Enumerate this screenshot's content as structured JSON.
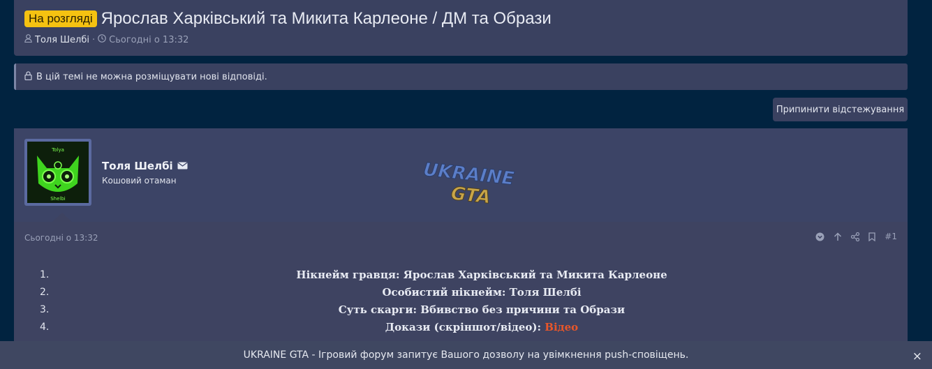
{
  "thread": {
    "status_badge": "На розгляді",
    "title": "Ярослав Харківський та Микита Карлеоне / ДМ та Образи",
    "author": "Толя Шелбі",
    "separator": "·",
    "date": "Сьогодні о 13:32"
  },
  "notice": {
    "text": "В цій темі не можна розміщувати нові відповіді."
  },
  "actions": {
    "unwatch_label": "Припинити відстежування"
  },
  "post": {
    "user_name": "Толя Шелбі",
    "user_title": "Кошовий отаман",
    "avatar_text_top": "Tolya",
    "avatar_text_bottom": "Shelbi",
    "watermark_line1": "UKRAINE",
    "watermark_line2": "GTA",
    "date": "Сьогодні о 13:32",
    "number": "#1",
    "items": [
      {
        "num": "1.",
        "text": "Нікнейм гравця: Ярослав Харківський та Микита Карлеоне"
      },
      {
        "num": "2.",
        "text": "Особистий нікнейм: Толя Шелбі"
      },
      {
        "num": "3.",
        "text": "Суть скарги: Вбивство без причини та Образи"
      },
      {
        "num": "4.",
        "text": "Докази (скріншот/відео): ",
        "link": "Відео"
      }
    ]
  },
  "push_bar": {
    "text": "UKRAINE GTA - Ігровий форум запитує Вашого дозволу на увімкнення push-сповіщень.",
    "close": "×"
  },
  "colors": {
    "badge": "#f5c211",
    "link": "#e8562a",
    "background": "#012340",
    "panel": "#3a4160"
  },
  "icons": [
    "user-icon",
    "clock-icon",
    "lock-icon",
    "envelope-icon",
    "chevron-circle-down-icon",
    "arrow-up-icon",
    "share-icon",
    "bookmark-icon",
    "close-icon"
  ]
}
